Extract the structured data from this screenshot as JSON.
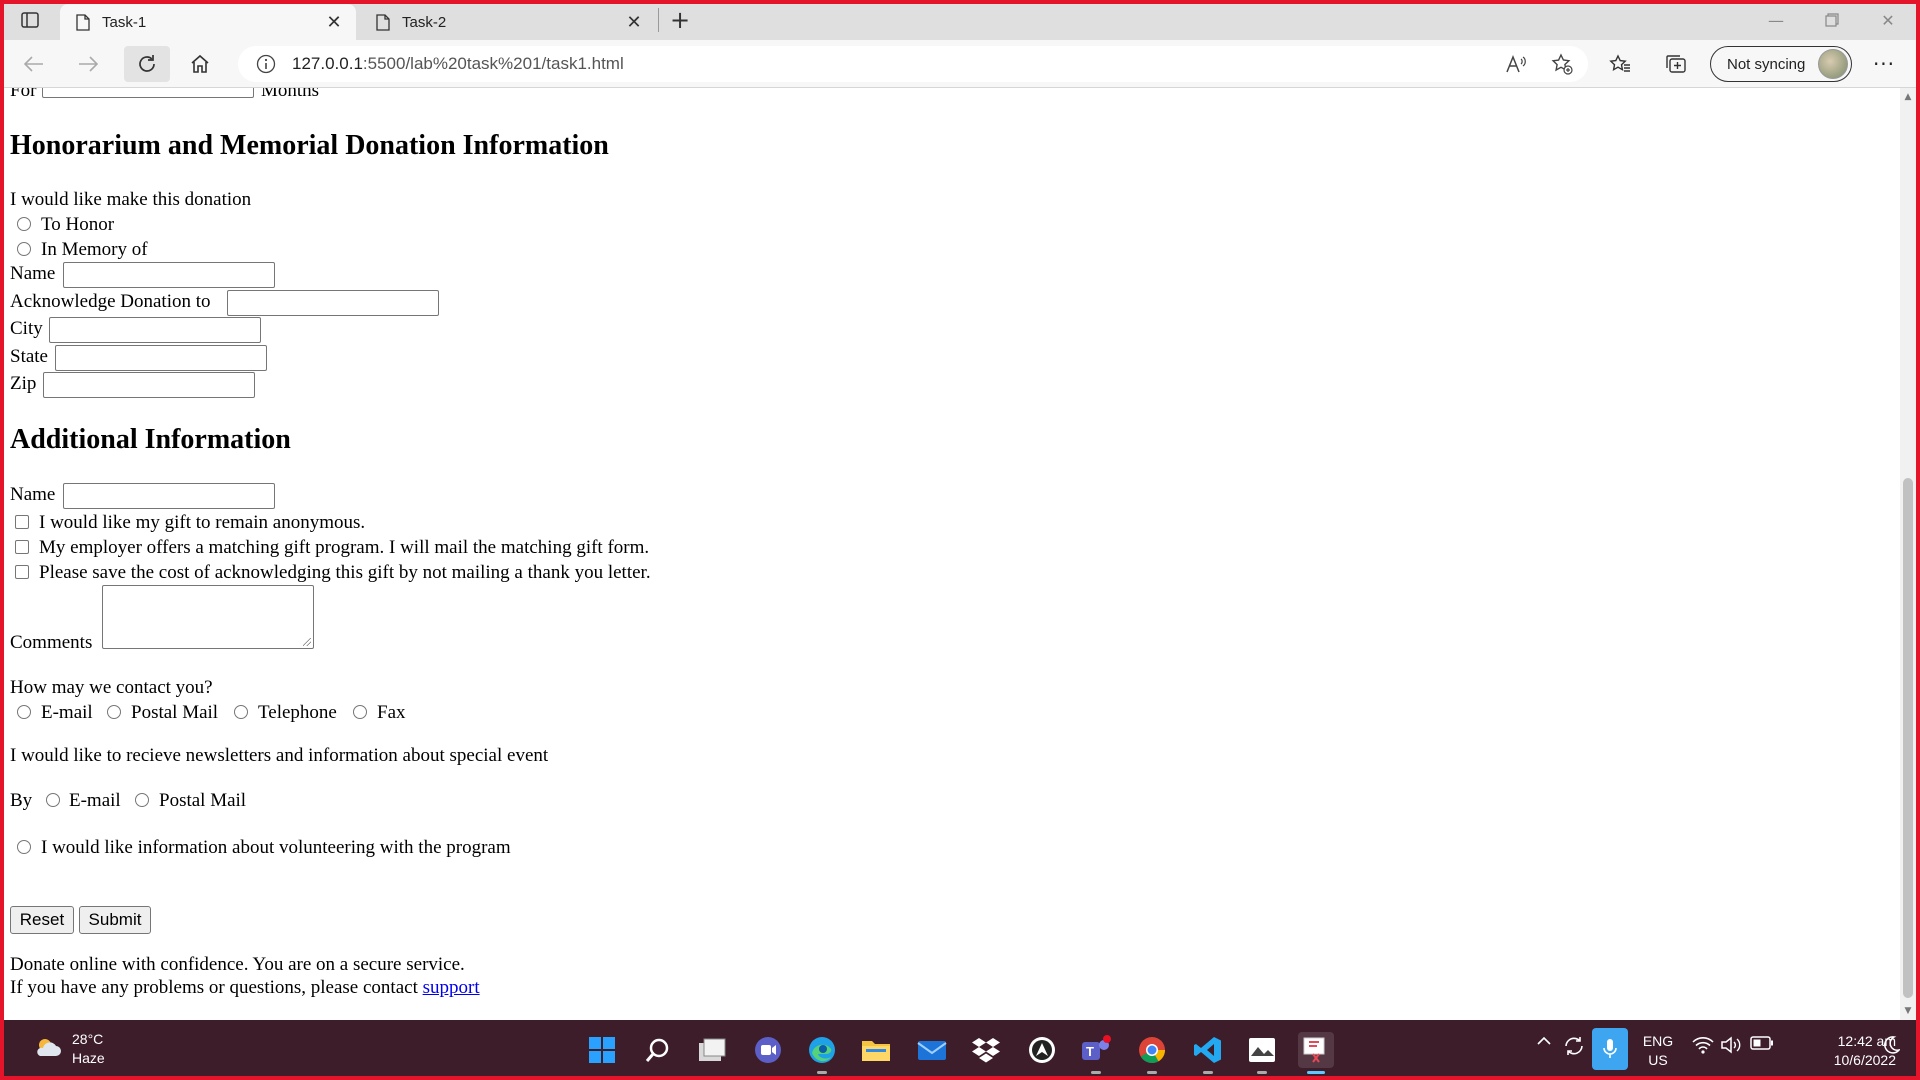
{
  "browser": {
    "tabs": [
      {
        "title": "Task-1",
        "active": true
      },
      {
        "title": "Task-2",
        "active": false
      }
    ],
    "url_host": "127.0.0.1",
    "url_path": ":5500/lab%20task%201/task1.html",
    "sync_label": "Not syncing",
    "more_label": "···",
    "new_tab_label": "+"
  },
  "page": {
    "months_row": {
      "prefix": "For",
      "suffix": "Months"
    },
    "honorarium": {
      "heading": "Honorarium and Memorial Donation Information",
      "intro": "I would like make this donation",
      "option_honor": "To Honor",
      "option_memory": "In Memory of",
      "name_label": "Name",
      "acknowledge_label": "Acknowledge Donation to",
      "city_label": "City",
      "state_label": "State",
      "zip_label": "Zip"
    },
    "additional": {
      "heading": "Additional Information",
      "name_label": "Name",
      "check_anonymous": "I would like my gift to remain anonymous.",
      "check_employer": "My employer offers a matching gift program. I will mail the matching gift form.",
      "check_no_letter": "Please save the cost of acknowledging this gift by not mailing a thank you letter.",
      "comments_label": "Comments"
    },
    "contact": {
      "question": "How may we contact you?",
      "options": [
        "E-mail",
        "Postal Mail",
        "Telephone",
        "Fax"
      ]
    },
    "newsletter": {
      "text": "I would like to recieve newsletters and information about special event",
      "by_label": "By",
      "options": [
        "E-mail",
        "Postal Mail"
      ]
    },
    "volunteer_text": "I would like information about volunteering with the program",
    "buttons": {
      "reset": "Reset",
      "submit": "Submit"
    },
    "footer": {
      "line1": "Donate online with confidence. You are on a secure service.",
      "line2": "If you have any problems or questions, please contact",
      "link": "support"
    }
  },
  "taskbar": {
    "weather_temp": "28°C",
    "weather_desc": "Haze",
    "lang_top": "ENG",
    "lang_bottom": "US",
    "time": "12:42 am",
    "date": "10/6/2022"
  },
  "colors": {
    "recording_border": "#e4142a",
    "taskbar_bg": "#3d1d2a",
    "link": "#0000ee"
  }
}
